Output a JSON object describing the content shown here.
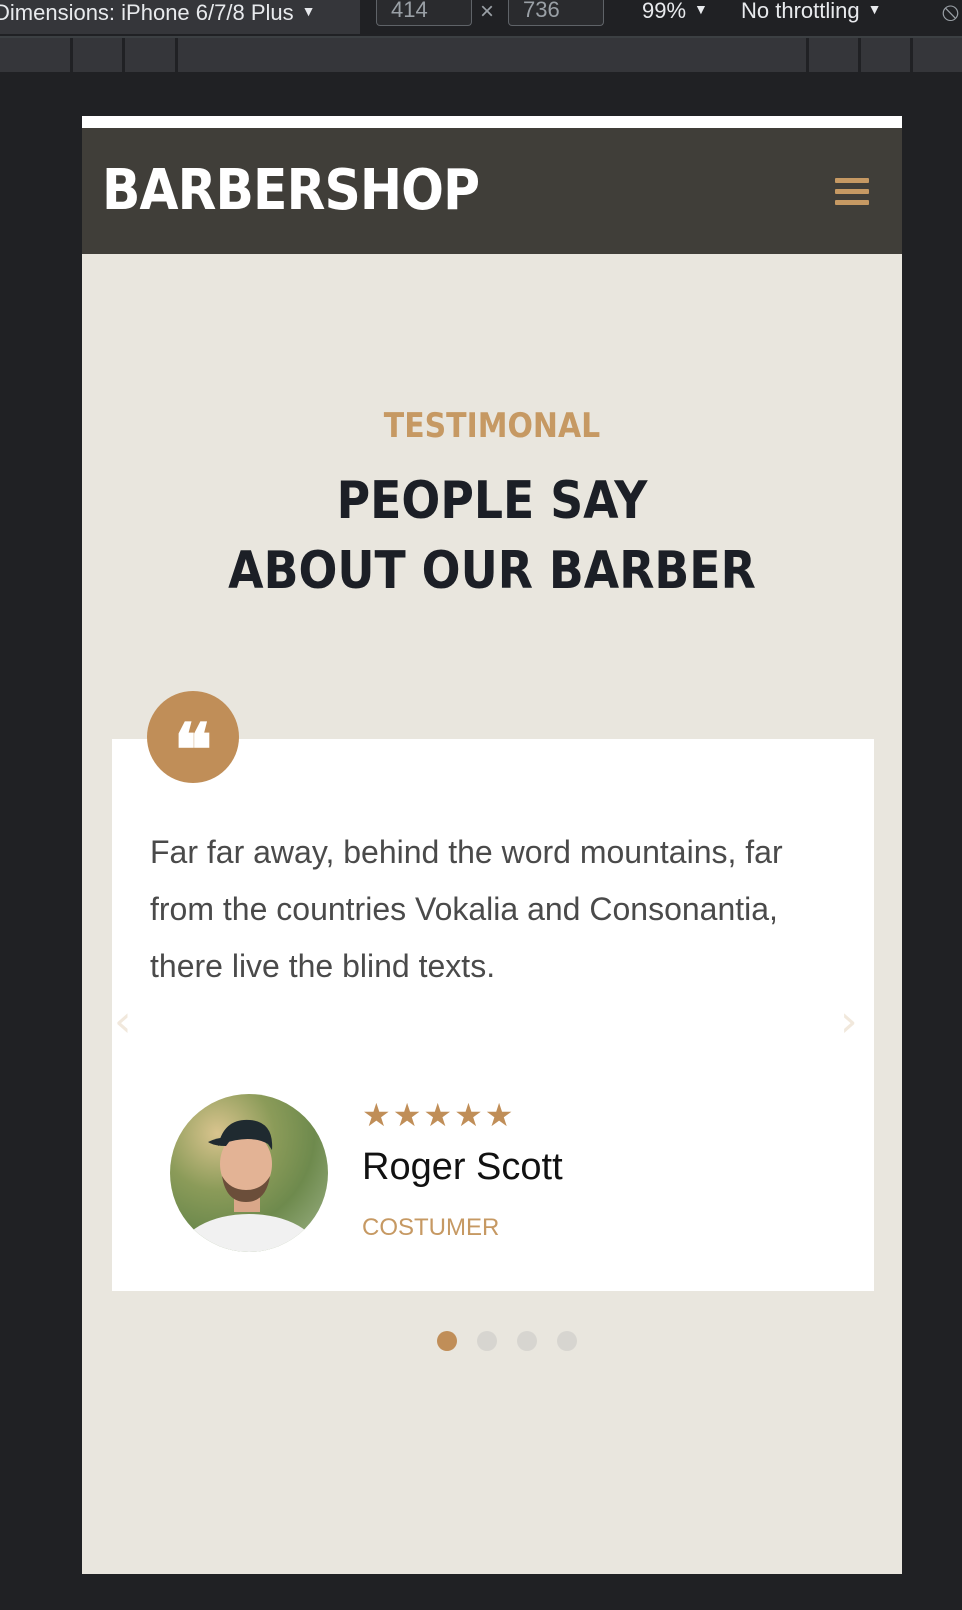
{
  "devtools": {
    "dimensions_label": "Dimensions: iPhone 6/7/8 Plus",
    "width": "414",
    "height": "736",
    "times": "×",
    "zoom": "99%",
    "throttling": "No throttling"
  },
  "navbar": {
    "logo": "BARBERSHOP",
    "menu_icon": "hamburger-icon"
  },
  "section": {
    "eyebrow": "TESTIMONAL",
    "heading_line1": "PEOPLE SAY",
    "heading_line2": "ABOUT OUR BARBER"
  },
  "testimonial": {
    "quote_icon": "quote-icon",
    "quote_glyph": "❝",
    "text": "Far far away, behind the word mountains, far from the countries Vokalia and Consonantia, there live the blind texts.",
    "stars": "★★★★★",
    "rating": 5,
    "name": "Roger Scott",
    "role": "COSTUMER"
  },
  "carousel": {
    "prev": "‹",
    "next": "›",
    "dots": 4,
    "active_dot": 1
  },
  "colors": {
    "accent": "#c69963",
    "navbar": "#403e39",
    "page_bg": "#e9e6de",
    "heading": "#1c1f26"
  }
}
